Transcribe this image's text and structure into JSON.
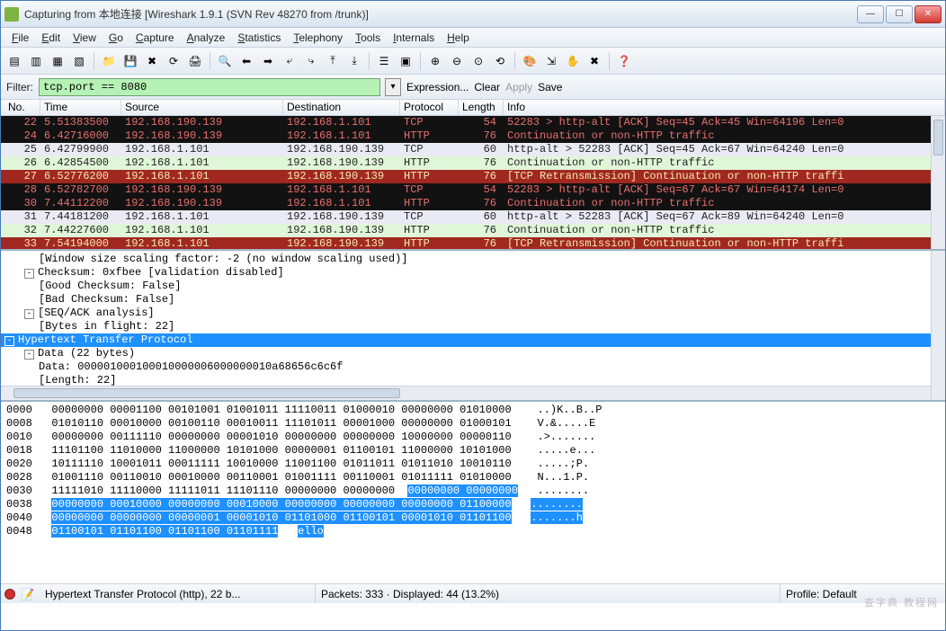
{
  "title": "Capturing from 本地连接   [Wireshark 1.9.1  (SVN Rev 48270 from /trunk)]",
  "menu": [
    "File",
    "Edit",
    "View",
    "Go",
    "Capture",
    "Analyze",
    "Statistics",
    "Telephony",
    "Tools",
    "Internals",
    "Help"
  ],
  "toolbar_icons": [
    "list",
    "list2",
    "list3",
    "list4",
    "sep",
    "folder",
    "save",
    "close",
    "refresh",
    "print",
    "sep",
    "search",
    "back-green",
    "fwd-green",
    "step-back",
    "step-fwd",
    "jump",
    "last",
    "sep",
    "layout1",
    "layout2",
    "sep",
    "zoom-in",
    "zoom-out",
    "zoom-fit",
    "autoscroll",
    "sep",
    "colorize",
    "autoresize",
    "filter-cap",
    "stop-cap",
    "sep",
    "help"
  ],
  "filter": {
    "label": "Filter:",
    "value": "tcp.port == 8080",
    "links": [
      "Expression...",
      "Clear",
      "Apply",
      "Save"
    ]
  },
  "columns": [
    "No.",
    "Time",
    "Source",
    "Destination",
    "Protocol",
    "Length",
    "Info"
  ],
  "packets": [
    {
      "cls": "r-blkred",
      "no": "22",
      "time": "5.51383500",
      "src": "192.168.190.139",
      "dst": "192.168.1.101",
      "proto": "TCP",
      "len": "54",
      "info": "52283 > http-alt [ACK] Seq=45 Ack=45 Win=64196 Len=0"
    },
    {
      "cls": "r-blkred",
      "no": "24",
      "time": "6.42716000",
      "src": "192.168.190.139",
      "dst": "192.168.1.101",
      "proto": "HTTP",
      "len": "76",
      "info": "Continuation or non-HTTP traffic"
    },
    {
      "cls": "r-lite",
      "no": "25",
      "time": "6.42799900",
      "src": "192.168.1.101",
      "dst": "192.168.190.139",
      "proto": "TCP",
      "len": "60",
      "info": "http-alt > 52283 [ACK] Seq=45 Ack=67 Win=64240 Len=0"
    },
    {
      "cls": "r-litegr",
      "no": "26",
      "time": "6.42854500",
      "src": "192.168.1.101",
      "dst": "192.168.190.139",
      "proto": "HTTP",
      "len": "76",
      "info": "Continuation or non-HTTP traffic"
    },
    {
      "cls": "r-red",
      "no": "27",
      "time": "6.52776200",
      "src": "192.168.1.101",
      "dst": "192.168.190.139",
      "proto": "HTTP",
      "len": "76",
      "info": "[TCP Retransmission] Continuation or non-HTTP traffi"
    },
    {
      "cls": "r-blkred",
      "no": "28",
      "time": "6.52782700",
      "src": "192.168.190.139",
      "dst": "192.168.1.101",
      "proto": "TCP",
      "len": "54",
      "info": "52283 > http-alt [ACK] Seq=67 Ack=67 Win=64174 Len=0"
    },
    {
      "cls": "r-blkred",
      "no": "30",
      "time": "7.44112200",
      "src": "192.168.190.139",
      "dst": "192.168.1.101",
      "proto": "HTTP",
      "len": "76",
      "info": "Continuation or non-HTTP traffic"
    },
    {
      "cls": "r-lite",
      "no": "31",
      "time": "7.44181200",
      "src": "192.168.1.101",
      "dst": "192.168.190.139",
      "proto": "TCP",
      "len": "60",
      "info": "http-alt > 52283 [ACK] Seq=67 Ack=89 Win=64240 Len=0"
    },
    {
      "cls": "r-litegr",
      "no": "32",
      "time": "7.44227600",
      "src": "192.168.1.101",
      "dst": "192.168.190.139",
      "proto": "HTTP",
      "len": "76",
      "info": "Continuation or non-HTTP traffic"
    },
    {
      "cls": "r-red",
      "no": "33",
      "time": "7.54194000",
      "src": "192.168.1.101",
      "dst": "192.168.190.139",
      "proto": "HTTP",
      "len": "76",
      "info": "[TCP Retransmission] Continuation or non-HTTP traffi"
    }
  ],
  "detail": {
    "lines": [
      {
        "ind": 2,
        "tw": "",
        "text": "[Window size scaling factor: -2 (no window scaling used)]"
      },
      {
        "ind": 1,
        "tw": "-",
        "text": "Checksum: 0xfbee [validation disabled]"
      },
      {
        "ind": 2,
        "tw": "",
        "text": "[Good Checksum: False]"
      },
      {
        "ind": 2,
        "tw": "",
        "text": "[Bad Checksum: False]"
      },
      {
        "ind": 1,
        "tw": "-",
        "text": "[SEQ/ACK analysis]"
      },
      {
        "ind": 2,
        "tw": "",
        "text": "[Bytes in flight: 22]"
      },
      {
        "ind": 0,
        "tw": "-",
        "text": "Hypertext Transfer Protocol",
        "hl": true
      },
      {
        "ind": 1,
        "tw": "-",
        "text": "Data (22 bytes)"
      },
      {
        "ind": 2,
        "tw": "",
        "text": "Data: 000001000100010000006000000010a68656c6c6f"
      },
      {
        "ind": 2,
        "tw": "",
        "text": "[Length: 22]"
      }
    ]
  },
  "hex": [
    {
      "off": "0000",
      "b": "00000000 00001100 00101001 01001011 11110011 01000010 00000000 01010000",
      "a": "..)K..B..P"
    },
    {
      "off": "0008",
      "b": "01010110 00010000 00100110 00010011 11101011 00001000 00000000 01000101",
      "a": "V.&.....E"
    },
    {
      "off": "0010",
      "b": "00000000 00111110 00000000 00001010 00000000 00000000 10000000 00000110",
      "a": ".>......."
    },
    {
      "off": "0018",
      "b": "11101100 11010000 11000000 10101000 00000001 01100101 11000000 10101000",
      "a": ".....e..."
    },
    {
      "off": "0020",
      "b": "10111110 10001011 00011111 10010000 11001100 01011011 01011010 10010110",
      "a": ".....;P."
    },
    {
      "off": "0028",
      "b": "01001110 00110010 00010000 00110001 01001111 00110001 01011111 01010000",
      "a": "N...1.P."
    },
    {
      "off": "0030",
      "b": "11111010 11110000 11111011 11101110 00000000 00000000 ",
      "a": "........",
      "selb": "00000000 00000000",
      "sela": ""
    },
    {
      "off": "0038",
      "selb": "00000000 00010000 00000000 00010000 00000000 00000000 00000000 01100000",
      "sela": "........"
    },
    {
      "off": "0040",
      "selb": "00000000 00000000 00000001 00001010 01101000 01100101 00001010 01101100",
      "sela": ".......h"
    },
    {
      "off": "0048",
      "selb": "01100101 01101100 01101100 01101111",
      "sela": "ello"
    }
  ],
  "status": {
    "proto": "Hypertext Transfer Protocol (http), 22 b...",
    "pkts": "Packets: 333 · Displayed: 44 (13.2%)",
    "profile": "Profile: Default"
  },
  "watermark": "查字典 教程网"
}
